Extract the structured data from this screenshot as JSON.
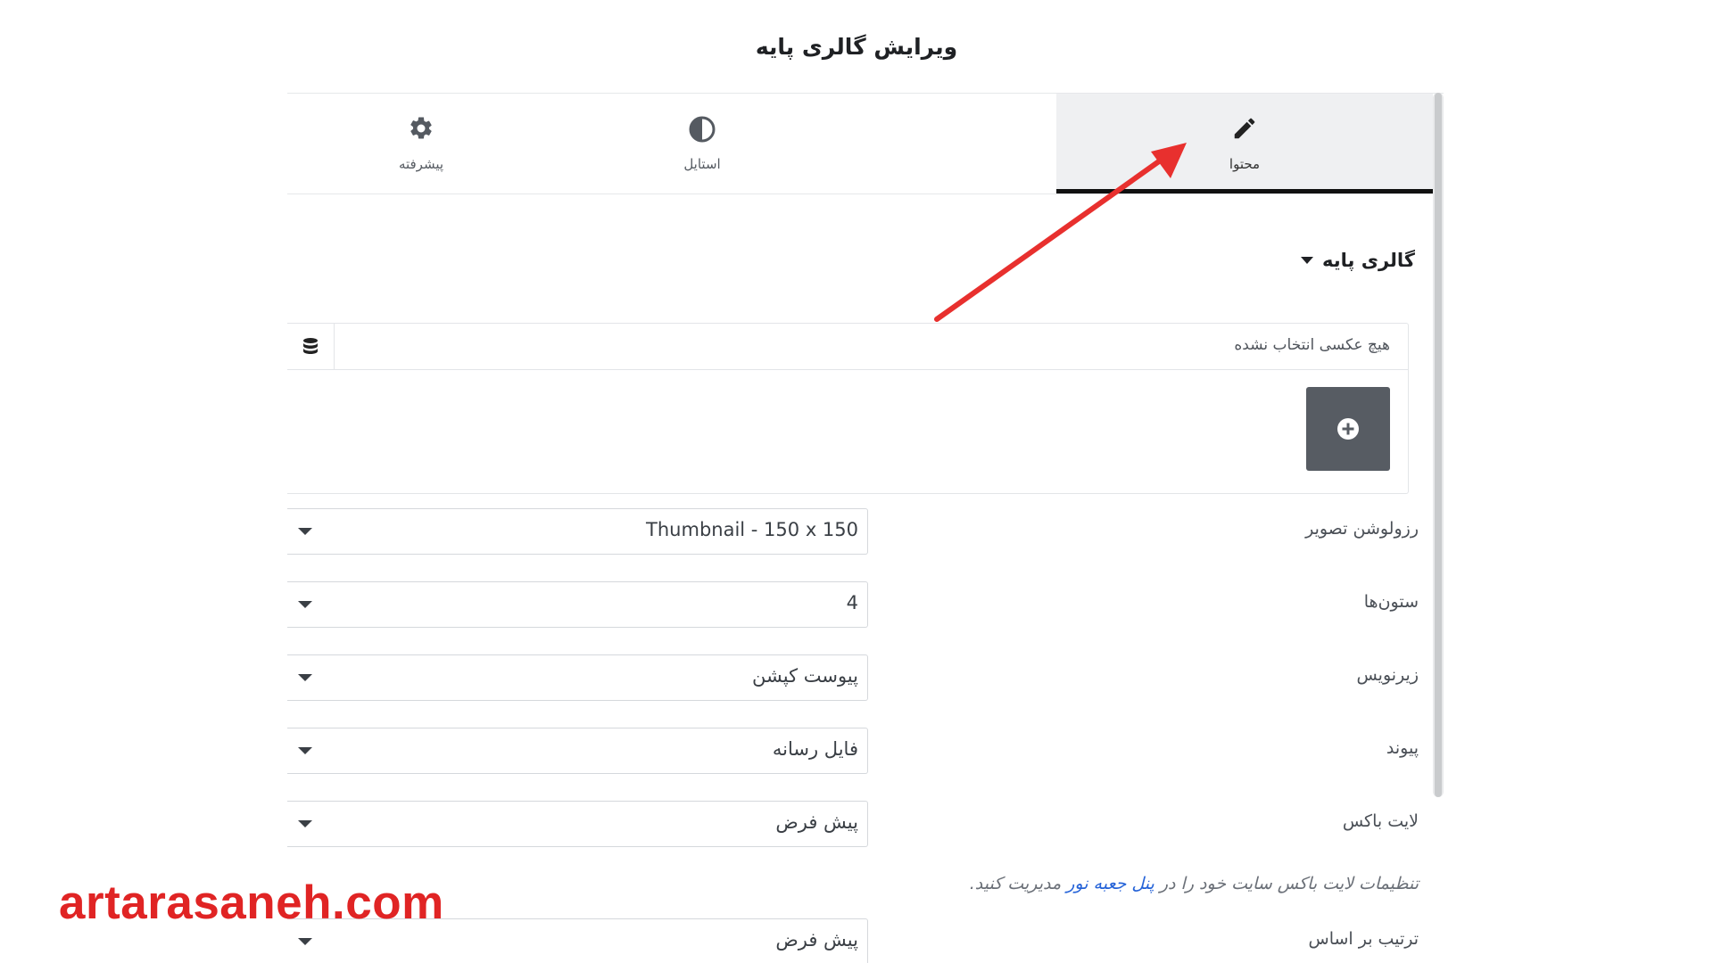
{
  "dialog": {
    "title": "ویرایش گالری پایه"
  },
  "tabs": [
    {
      "label": "پیشرفته",
      "icon": "gear-icon"
    },
    {
      "label": "استایل",
      "icon": "half-circle-icon"
    },
    {
      "label": "محتوا",
      "icon": "pencil-icon",
      "active": true
    }
  ],
  "section": {
    "title": "گالری پایه",
    "icon": "caret-down-icon"
  },
  "gallery": {
    "empty_text": "هیچ عکسی انتخاب نشده",
    "db_icon": "database-icon",
    "add_icon": "plus-circle-icon"
  },
  "fields": [
    {
      "label": "رزولوشن تصویر",
      "value": "Thumbnail - 150 x 150"
    },
    {
      "label": "ستون‌ها",
      "value": "4"
    },
    {
      "label": "زیرنویس",
      "value": "پیوست کپشن"
    },
    {
      "label": "پیوند",
      "value": "فایل رسانه"
    },
    {
      "label": "لایت باکس",
      "value": "پیش فرض"
    },
    {
      "label": "ترتیب بر اساس",
      "value": "پیش فرض"
    }
  ],
  "note": {
    "before": "تنظیمات لایت باکس سایت خود را در ",
    "link": "پنل جعبه نور",
    "after": " مدیریت کنید."
  },
  "watermark": {
    "text": "artarasaneh.com"
  },
  "colors": {
    "accent_arrow": "#e8302e",
    "brand": "#e02424",
    "active_tab_bg": "#eff0f2",
    "add_button": "#575c63"
  }
}
